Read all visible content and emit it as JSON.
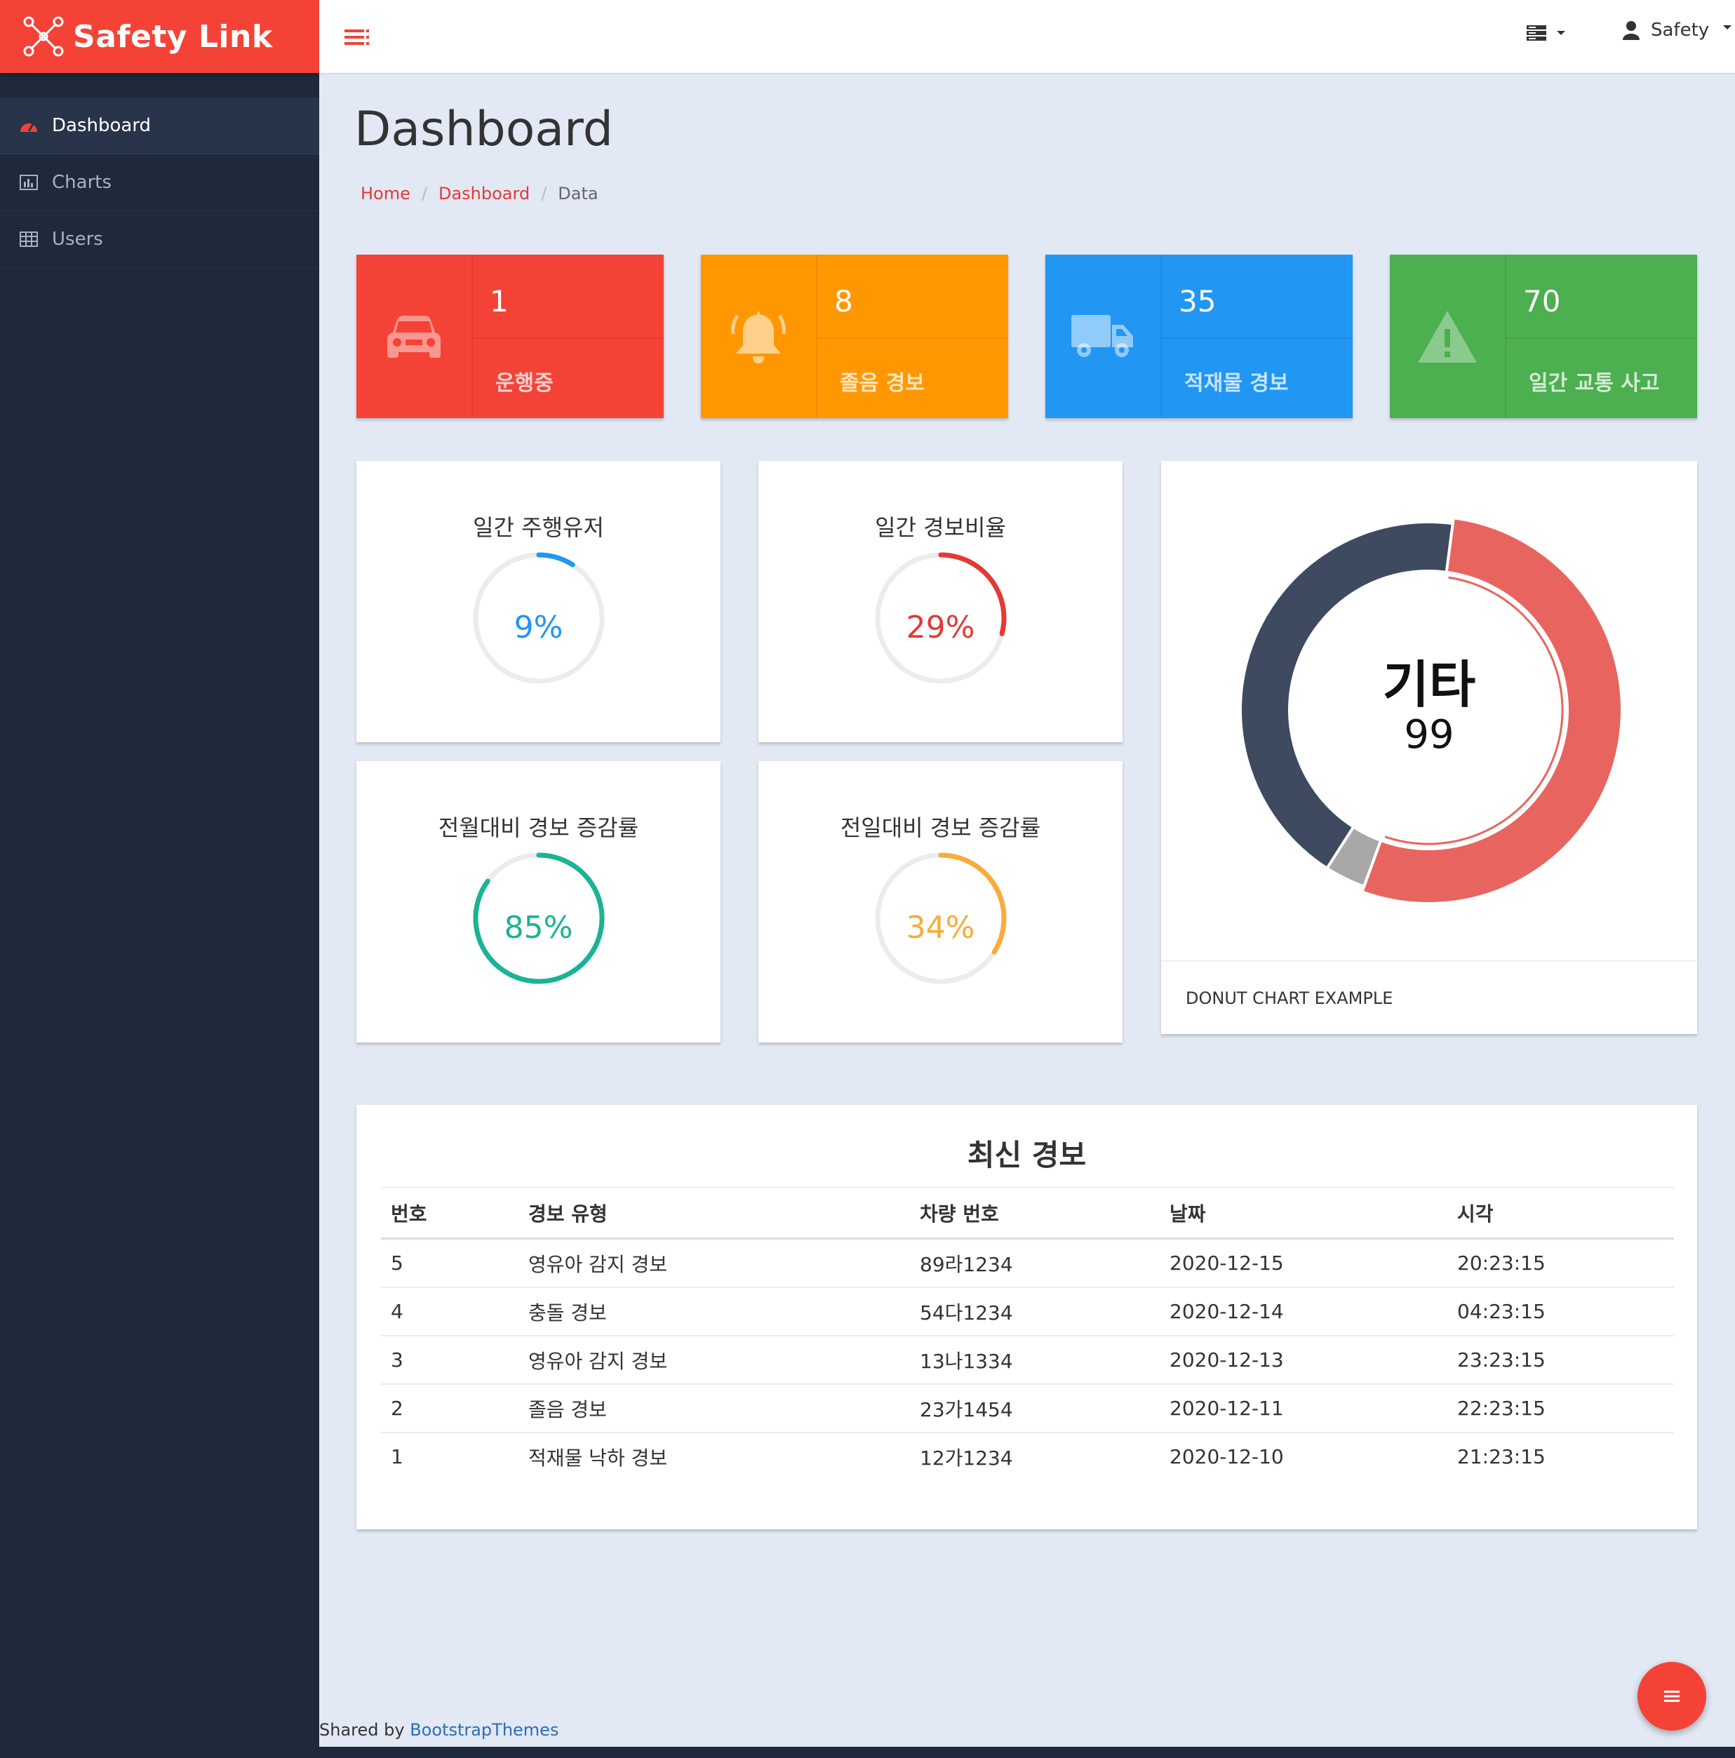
{
  "app": {
    "brand_name": "Safety Link",
    "accent": "#f44336"
  },
  "sidebar": {
    "items": [
      {
        "label": "Dashboard",
        "icon": "dashboard-icon",
        "active": true
      },
      {
        "label": "Charts",
        "icon": "bar-chart-icon",
        "active": false
      },
      {
        "label": "Users",
        "icon": "table-icon",
        "active": false
      }
    ]
  },
  "topbar": {
    "user_name": "Safety",
    "icons": [
      "menu-toggle-icon",
      "server-icon",
      "user-icon"
    ]
  },
  "page": {
    "title": "Dashboard"
  },
  "breadcrumb": {
    "items": [
      "Home",
      "Dashboard"
    ],
    "current": "Data"
  },
  "stats": [
    {
      "value": "1",
      "label": "운행중",
      "color": "#f44336",
      "icon": "car-icon"
    },
    {
      "value": "8",
      "label": "졸음 경보",
      "color": "#ff9800",
      "icon": "bell-icon"
    },
    {
      "value": "35",
      "label": "적재물 경보",
      "color": "#2196f3",
      "icon": "truck-icon"
    },
    {
      "value": "70",
      "label": "일간 교통 사고",
      "color": "#4caf50",
      "icon": "warning-icon"
    }
  ],
  "gauges": [
    {
      "title": "일간 주행유저",
      "percent": 9,
      "label": "9%",
      "color": "#2196f3"
    },
    {
      "title": "일간 경보비율",
      "percent": 29,
      "label": "29%",
      "color": "#e53935"
    },
    {
      "title": "전월대비 경보 증감률",
      "percent": 85,
      "label": "85%",
      "color": "#1ab394"
    },
    {
      "title": "전일대비 경보 증감률",
      "percent": 34,
      "label": "34%",
      "color": "#f8ac3b"
    }
  ],
  "donut": {
    "center_label": "기타",
    "center_value": "99",
    "caption": "DONUT CHART EXAMPLE",
    "segments": [
      {
        "fraction": 0.535,
        "color": "#e8655f",
        "highlighted": true
      },
      {
        "fraction": 0.035,
        "color": "#a8a8a8"
      },
      {
        "fraction": 0.43,
        "color": "#3d4a5f"
      }
    ]
  },
  "table": {
    "title": "최신 경보",
    "columns": [
      "번호",
      "경보 유형",
      "차량 번호",
      "날짜",
      "시각"
    ],
    "rows": [
      [
        "5",
        "영유아 감지 경보",
        "89라1234",
        "2020-12-15",
        "20:23:15"
      ],
      [
        "4",
        "충돌 경보",
        "54다1234",
        "2020-12-14",
        "04:23:15"
      ],
      [
        "3",
        "영유아 감지 경보",
        "13나1334",
        "2020-12-13",
        "23:23:15"
      ],
      [
        "2",
        "졸음 경보",
        "23가1454",
        "2020-12-11",
        "22:23:15"
      ],
      [
        "1",
        "적재물 낙하 경보",
        "12가1234",
        "2020-12-10",
        "21:23:15"
      ]
    ]
  },
  "footer": {
    "prefix": "Shared by",
    "link_text": "BootstrapThemes"
  }
}
